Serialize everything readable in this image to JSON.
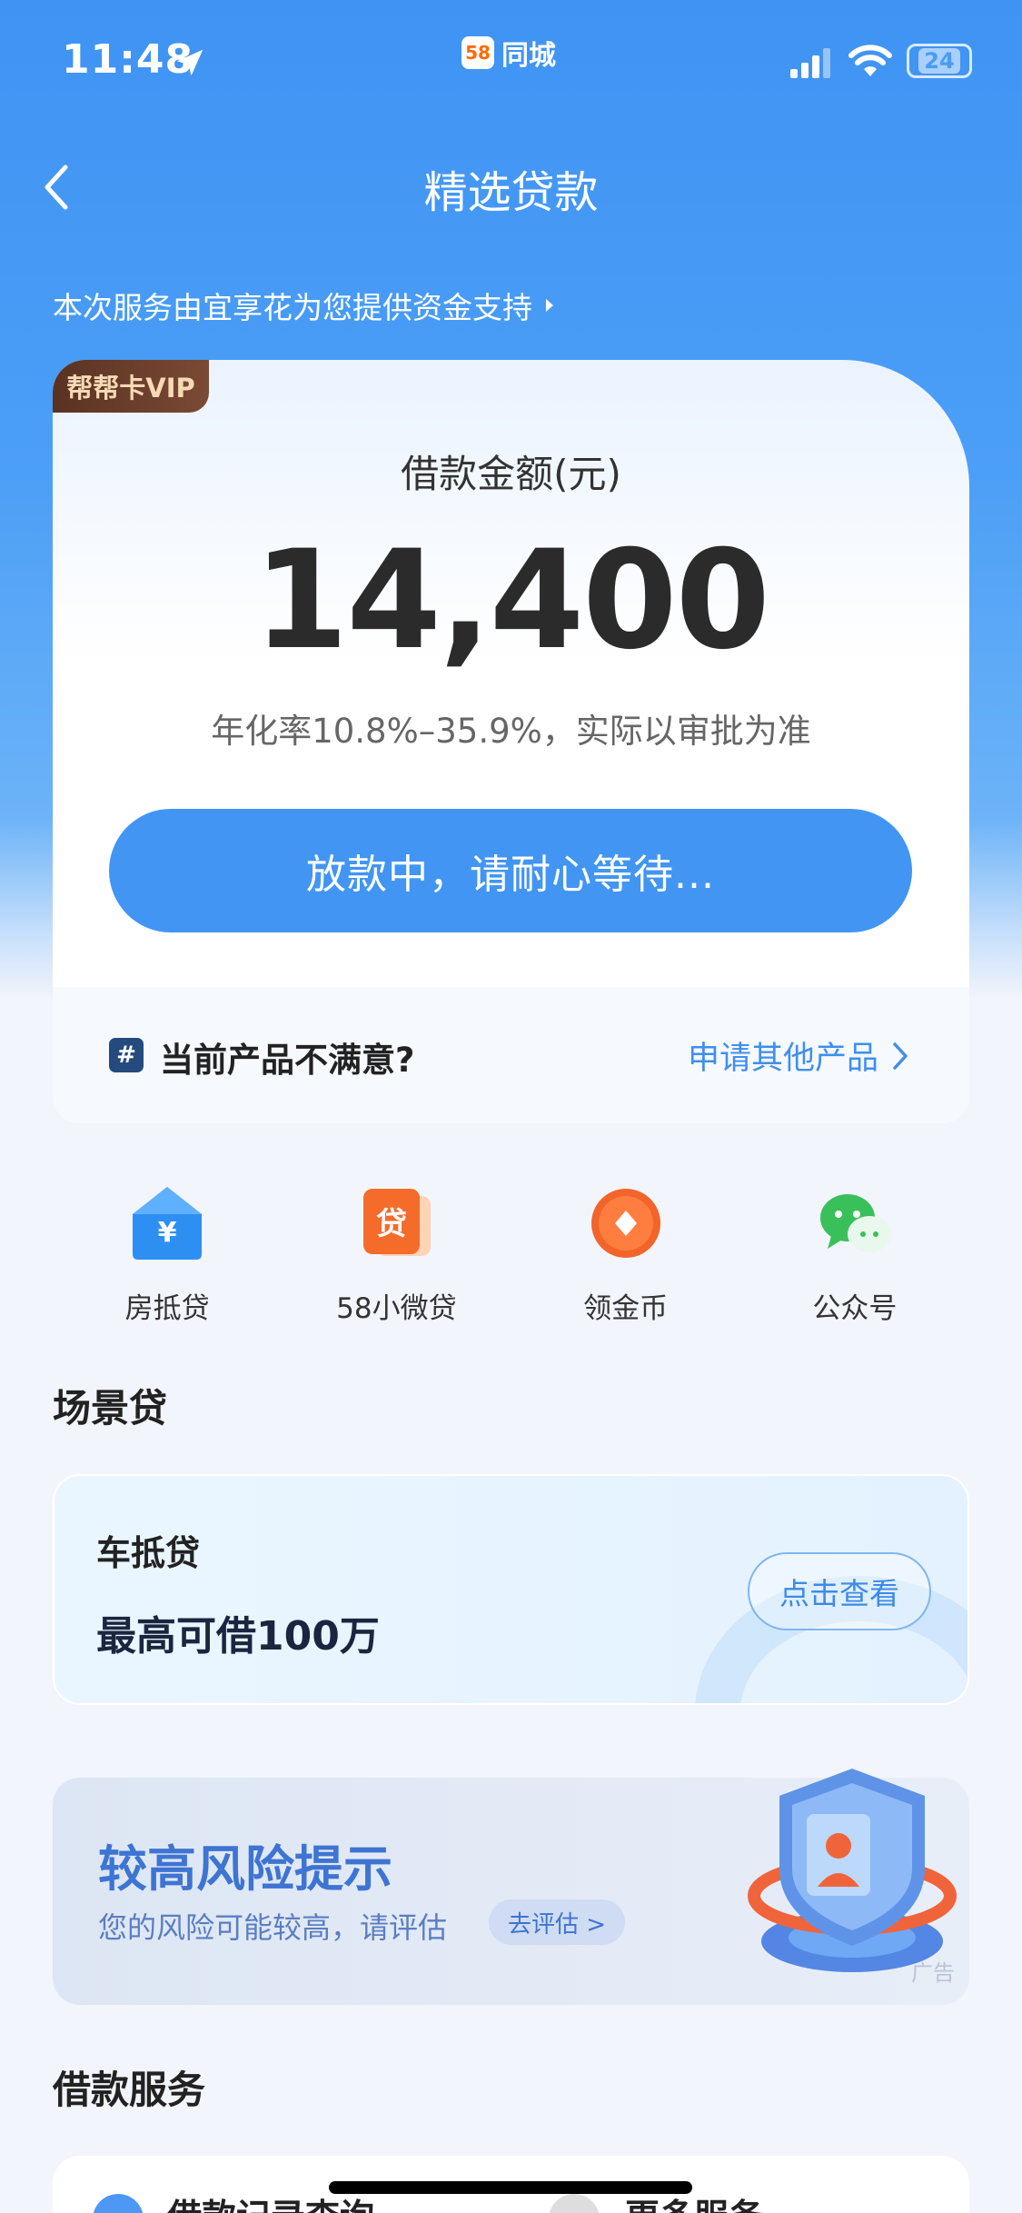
{
  "status_bar": {
    "time": "11:48",
    "carrier_logo": "58",
    "carrier_name": "同城",
    "battery": "24"
  },
  "nav": {
    "title": "精选贷款",
    "back_icon": "chevron-left-icon"
  },
  "provider_notice": "本次服务由宜享花为您提供资金支持",
  "loan_card": {
    "vip_badge": "帮帮卡VIP",
    "amount_label": "借款金额(元)",
    "amount": "14,400",
    "rate_note": "年化率10.8%–35.9%，实际以审批为准",
    "status_button": "放款中，请耐心等待...",
    "unsatisfied_text": "当前产品不满意?",
    "other_products_link": "申请其他产品"
  },
  "shortcuts": [
    {
      "label": "房抵贷",
      "icon": "house-yuan-icon"
    },
    {
      "label": "58小微贷",
      "icon": "loan-tag-icon"
    },
    {
      "label": "领金币",
      "icon": "coin-icon"
    },
    {
      "label": "公众号",
      "icon": "wechat-icon"
    }
  ],
  "scene_section": {
    "title": "场景贷",
    "card_name": "车抵贷",
    "card_sub": "最高可借100万",
    "card_button": "点击查看"
  },
  "risk_banner": {
    "title": "较高风险提示",
    "subtitle": "您的风险可能较高，请评估",
    "button": "去评估 >",
    "ad_tag": "广告"
  },
  "services_section": {
    "title": "借款服务",
    "items": [
      "借款记录查询",
      "更多服务"
    ]
  },
  "colors": {
    "primary": "#4295f3",
    "vip": "#5a3222",
    "risk_text": "#3e74d2"
  }
}
